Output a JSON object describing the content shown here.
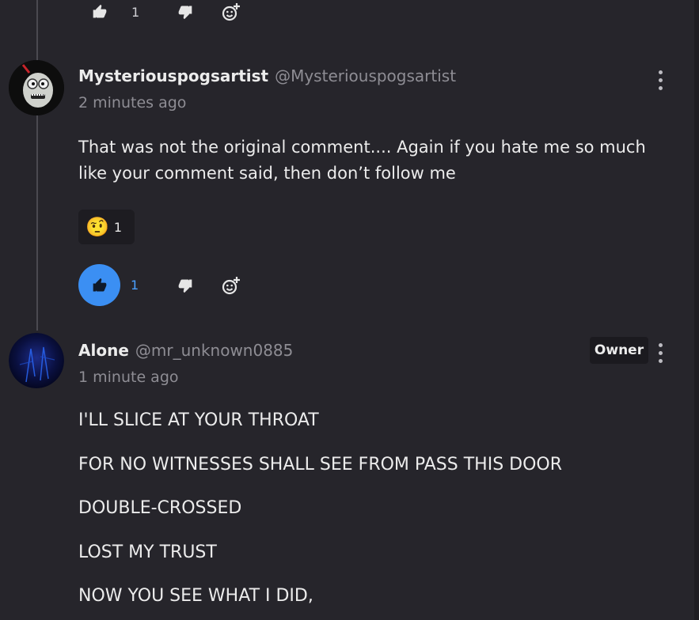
{
  "top_actions": {
    "like_count": "1"
  },
  "comment1": {
    "author": "Mysteriouspogsartist",
    "handle": "@Mysteriouspogsartist",
    "time": "2 minutes ago",
    "lines": [
      "That was not the original comment.... Again if you hate me so much",
      "like your comment said, then don’t follow me"
    ],
    "reaction": {
      "emoji": "🤨",
      "count": "1"
    },
    "like_count": "1",
    "liked": true
  },
  "comment2": {
    "author": "Alone",
    "handle": "@mr_unknown0885",
    "time": "1 minute ago",
    "badge": "Owner",
    "lines": [
      "I'LL SLICE AT YOUR THROAT",
      "FOR NO WITNESSES SHALL SEE FROM PASS THIS DOOR",
      "DOUBLE-CROSSED",
      "LOST MY TRUST",
      "NOW YOU SEE WHAT I DID,"
    ]
  },
  "colors": {
    "background": "#26252b",
    "like_active": "#3b8ff3",
    "muted_text": "#8e8d94"
  },
  "icons": [
    "thumbs-up-icon",
    "thumbs-down-icon",
    "add-reaction-icon",
    "more-vert-icon"
  ]
}
